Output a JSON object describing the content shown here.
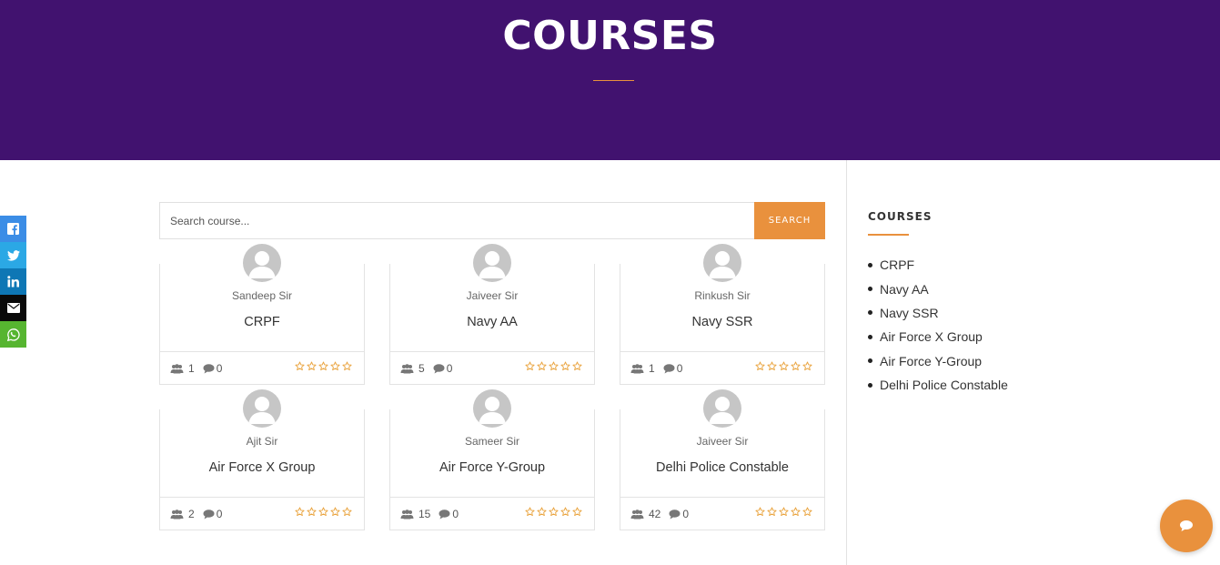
{
  "header": {
    "title": "COURSES"
  },
  "social": [
    {
      "icon": "facebook-icon",
      "color": "#3b8de6"
    },
    {
      "icon": "twitter-icon",
      "color": "#2ba8e5"
    },
    {
      "icon": "linkedin-icon",
      "color": "#0e77b5"
    },
    {
      "icon": "email-icon",
      "color": "#0a0a0a"
    },
    {
      "icon": "whatsapp-icon",
      "color": "#56b530"
    }
  ],
  "search": {
    "placeholder": "Search course...",
    "button": "SEARCH"
  },
  "courses": [
    {
      "instructor": "Sandeep Sir",
      "title": "CRPF",
      "students": "1",
      "comments": "0",
      "rating": 0
    },
    {
      "instructor": "Jaiveer Sir",
      "title": "Navy AA",
      "students": "5",
      "comments": "0",
      "rating": 0
    },
    {
      "instructor": "Rinkush Sir",
      "title": "Navy SSR",
      "students": "1",
      "comments": "0",
      "rating": 0
    },
    {
      "instructor": "Ajit Sir",
      "title": "Air Force X Group",
      "students": "2",
      "comments": "0",
      "rating": 0
    },
    {
      "instructor": "Sameer Sir",
      "title": "Air Force Y-Group",
      "students": "15",
      "comments": "0",
      "rating": 0
    },
    {
      "instructor": "Jaiveer Sir",
      "title": "Delhi Police Constable",
      "students": "42",
      "comments": "0",
      "rating": 0
    }
  ],
  "sidebar": {
    "title": "COURSES",
    "items": [
      "CRPF",
      "Navy AA",
      "Navy SSR",
      "Air Force X Group",
      "Air Force Y-Group",
      "Delhi Police Constable"
    ]
  },
  "colors": {
    "header_bg": "#41126f",
    "accent": "#e9913d",
    "star": "#e9a23b"
  },
  "chat": {
    "icon": "chat-bubble-icon"
  }
}
